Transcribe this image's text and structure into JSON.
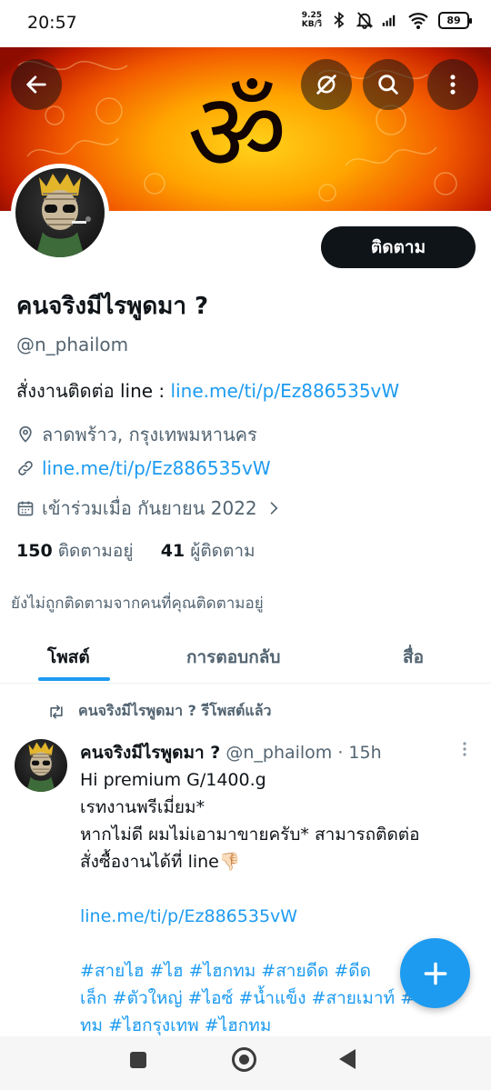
{
  "status": {
    "time": "20:57",
    "net_speed_value": "9.25",
    "net_speed_unit": "KB/วิ",
    "battery": "89"
  },
  "header": {
    "icons": [
      "back-arrow-icon",
      "grok-icon",
      "search-icon",
      "more-vertical-icon"
    ]
  },
  "profile": {
    "follow_label": "ติดตาม",
    "name": "คนจริงมีไรพูดมา ?",
    "handle": "@n_phailom",
    "bio_text": "สั่งงานติดต่อ line  : ",
    "bio_link": "line.me/ti/p/Ez886535vW",
    "location": "ลาดพร้าว, กรุงเทพมหานคร",
    "website": "line.me/ti/p/Ez886535vW",
    "joined": "เข้าร่วมเมื่อ กันยายน 2022",
    "following_count": "150",
    "following_label": "ติดตามอยู่",
    "followers_count": "41",
    "followers_label": "ผู้ติดตาม",
    "not_followed_note": "ยังไม่ถูกติดตามจากคนที่คุณติดตามอยู่"
  },
  "tabs": [
    {
      "label": "โพสต์",
      "active": true
    },
    {
      "label": "การตอบกลับ",
      "active": false
    },
    {
      "label": "สื่อ",
      "active": false
    }
  ],
  "post": {
    "repost_label": "คนจริงมีไรพูดมา ? รีโพสต์แล้ว",
    "author_name": "คนจริงมีไรพูดมา ?",
    "author_meta": " @n_phailom · 15h",
    "line1": "Hi premium G/1400.g",
    "line2": "เรทงานพรีเมี่ยม*",
    "line3": "หากไม่ดี ผมไม่เอามาขายครับ* สามารถติดต่อ",
    "line4": "สั่งซื้องานได้ที่ line👎🏻",
    "link": "line.me/ti/p/Ez886535vW",
    "tags1": "#สายไฮ #ไฮ #ไฮกทม #สายดีด #ดีด",
    "tags2": "เล็ก #ตัวใหญ่ #ไอซ์ #น้ำแข็ง #สายเมาท์ #ไฮก",
    "tags3": "ทม #ไฮกรุงเทพ #ไฮกทม"
  },
  "colors": {
    "accent": "#1d9bf0",
    "text_primary": "#0f1419",
    "text_secondary": "#536471"
  }
}
